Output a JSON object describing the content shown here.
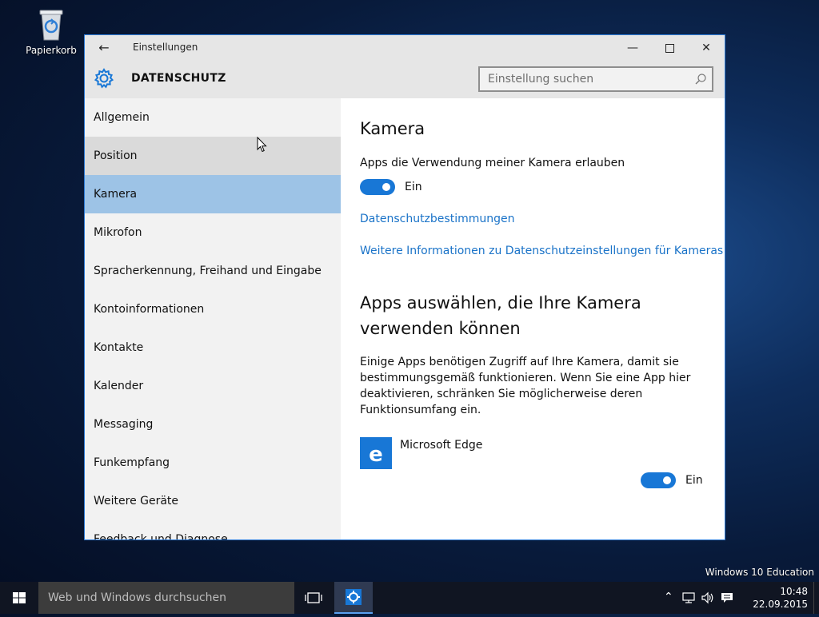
{
  "desktop": {
    "recycle_bin_label": "Papierkorb",
    "edition_watermark": "Windows 10 Education"
  },
  "window": {
    "title": "Einstellungen",
    "header_title": "DATENSCHUTZ",
    "search_placeholder": "Einstellung suchen",
    "accent_color": "#1877d6"
  },
  "sidebar": {
    "items": [
      {
        "label": "Allgemein"
      },
      {
        "label": "Position"
      },
      {
        "label": "Kamera"
      },
      {
        "label": "Mikrofon"
      },
      {
        "label": "Spracherkennung, Freihand und Eingabe"
      },
      {
        "label": "Kontoinformationen"
      },
      {
        "label": "Kontakte"
      },
      {
        "label": "Kalender"
      },
      {
        "label": "Messaging"
      },
      {
        "label": "Funkempfang"
      },
      {
        "label": "Weitere Geräte"
      },
      {
        "label": "Feedback und Diagnose"
      }
    ],
    "selected": "Kamera",
    "hovered": "Position"
  },
  "content": {
    "heading": "Kamera",
    "allow_label": "Apps die Verwendung meiner Kamera erlauben",
    "allow_toggle_state": "Ein",
    "privacy_link": "Datenschutzbestimmungen",
    "more_info_link": "Weitere Informationen zu Datenschutzeinstellungen für Kameras",
    "apps_heading": "Apps auswählen, die Ihre Kamera verwenden können",
    "apps_description": "Einige Apps benötigen Zugriff auf Ihre Kamera, damit sie bestimmungsgemäß funktionieren. Wenn Sie eine App hier deaktivieren, schränken Sie möglicherweise deren Funktionsumfang ein.",
    "apps": [
      {
        "name": "Microsoft Edge",
        "toggle_state": "Ein",
        "icon": "edge-icon"
      }
    ]
  },
  "taskbar": {
    "search_placeholder": "Web und Windows durchsuchen",
    "time": "10:48",
    "date": "22.09.2015"
  }
}
